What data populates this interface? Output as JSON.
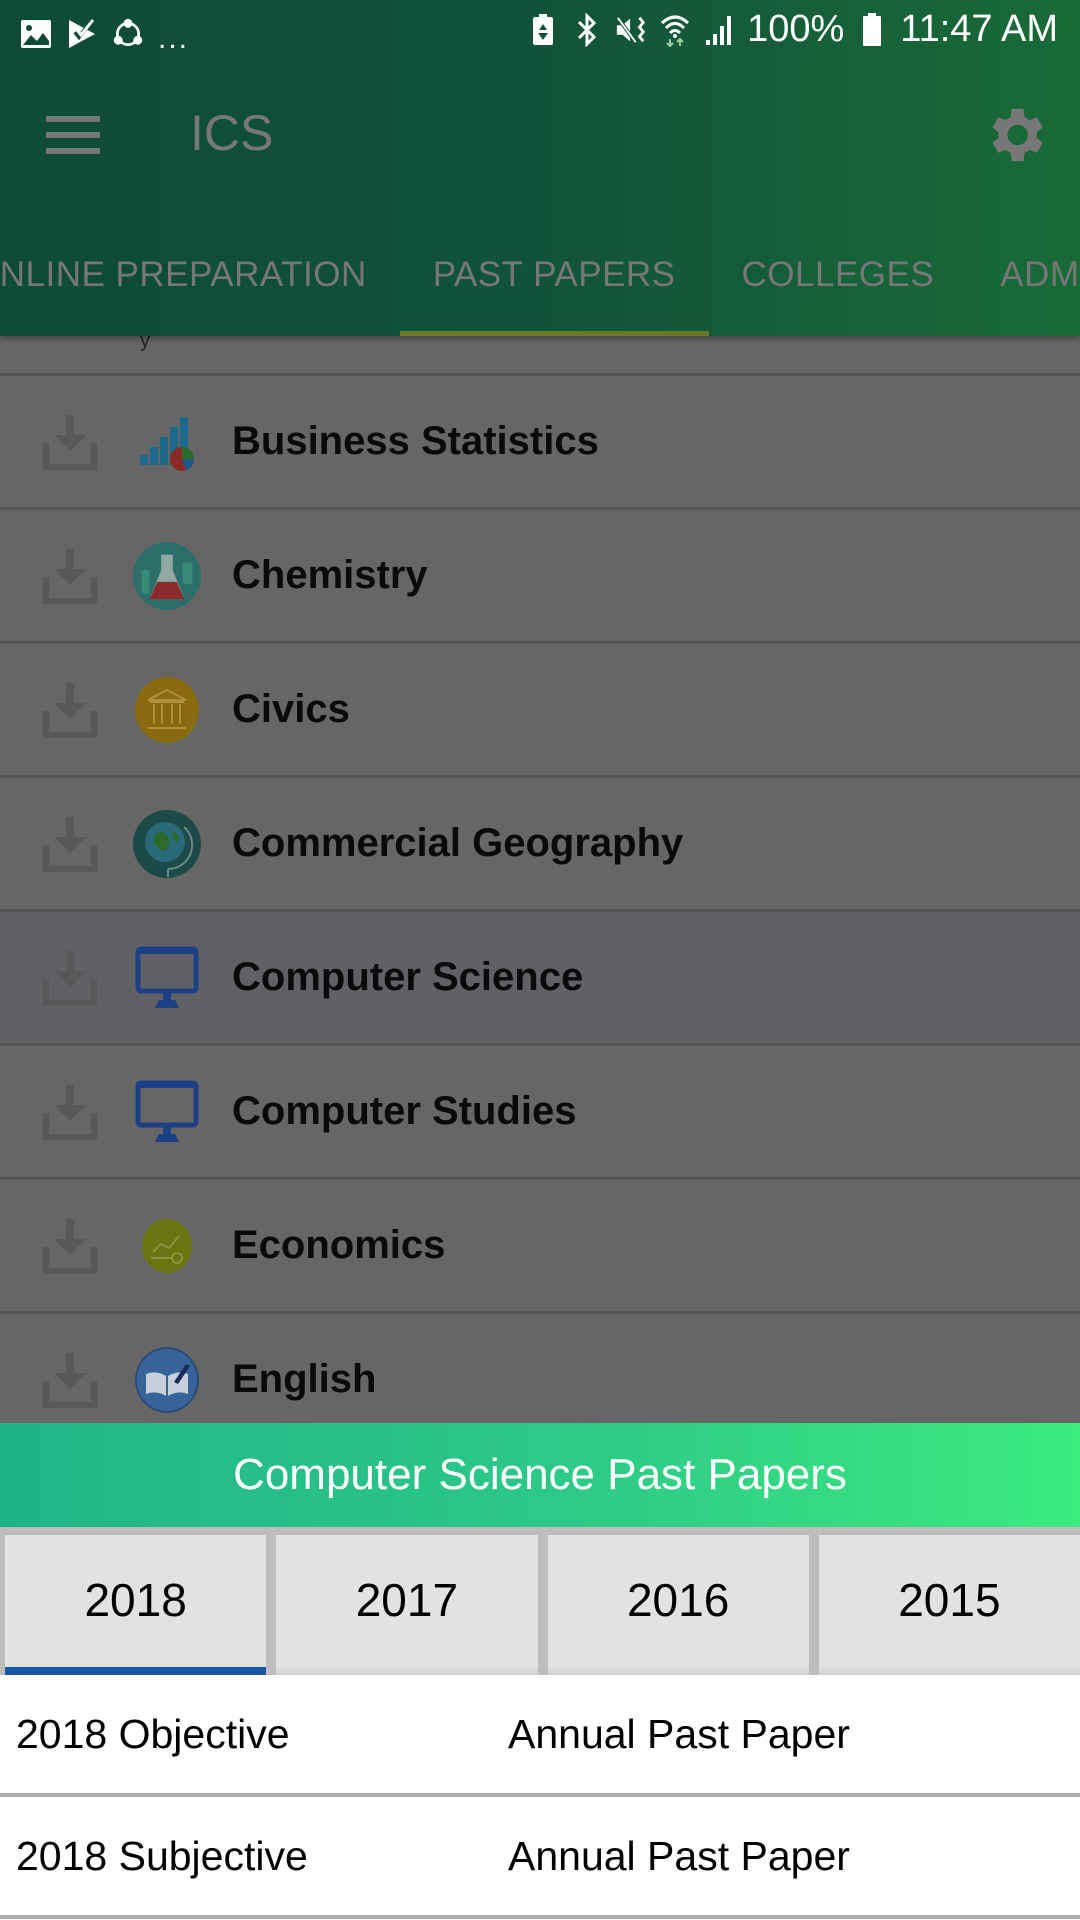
{
  "status_bar": {
    "left_icons": [
      "gallery-icon",
      "task-check-icon",
      "share-it-icon"
    ],
    "overflow": "...",
    "right_icons": [
      "battery-saver-icon",
      "bluetooth-icon",
      "mute-vibrate-icon",
      "wifi-icon",
      "signal-icon"
    ],
    "battery": "100%",
    "time": "11:47 AM"
  },
  "toolbar": {
    "menu_icon": "hamburger-menu-icon",
    "title": "ICS",
    "settings_icon": "gear-icon"
  },
  "tabs": [
    {
      "label": "ONLINE PREPARATION",
      "active": false
    },
    {
      "label": "PAST PAPERS",
      "active": true
    },
    {
      "label": "COLLEGES",
      "active": false
    },
    {
      "label": "ADMISSIONS",
      "active": false
    }
  ],
  "subjects": [
    {
      "label": "Business Statistics",
      "icon": "bar-chart-icon"
    },
    {
      "label": "Chemistry",
      "icon": "flask-icon"
    },
    {
      "label": "Civics",
      "icon": "government-building-icon"
    },
    {
      "label": "Commercial Geography",
      "icon": "globe-icon"
    },
    {
      "label": "Computer Science",
      "icon": "monitor-icon",
      "highlighted": true
    },
    {
      "label": "Computer Studies",
      "icon": "monitor-icon"
    },
    {
      "label": "Economics",
      "icon": "economics-icon"
    },
    {
      "label": "English",
      "icon": "book-pen-icon"
    }
  ],
  "sheet": {
    "title": "Computer Science Past Papers",
    "years": [
      {
        "label": "2018",
        "active": true
      },
      {
        "label": "2017",
        "active": false
      },
      {
        "label": "2016",
        "active": false
      },
      {
        "label": "2015",
        "active": false
      }
    ],
    "papers": [
      {
        "name": "2018 Objective",
        "type": "Annual Past Paper"
      },
      {
        "name": "2018 Subjective",
        "type": "Annual Past Paper"
      }
    ]
  },
  "colors": {
    "header_start": "#0e4a38",
    "header_end": "#1a6b38",
    "tab_indicator": "#6a7a22",
    "sheet_header_start": "#1fb487",
    "sheet_header_end": "#3cea7e",
    "year_indicator": "#1857a5",
    "overlay_gray": "#666666"
  }
}
